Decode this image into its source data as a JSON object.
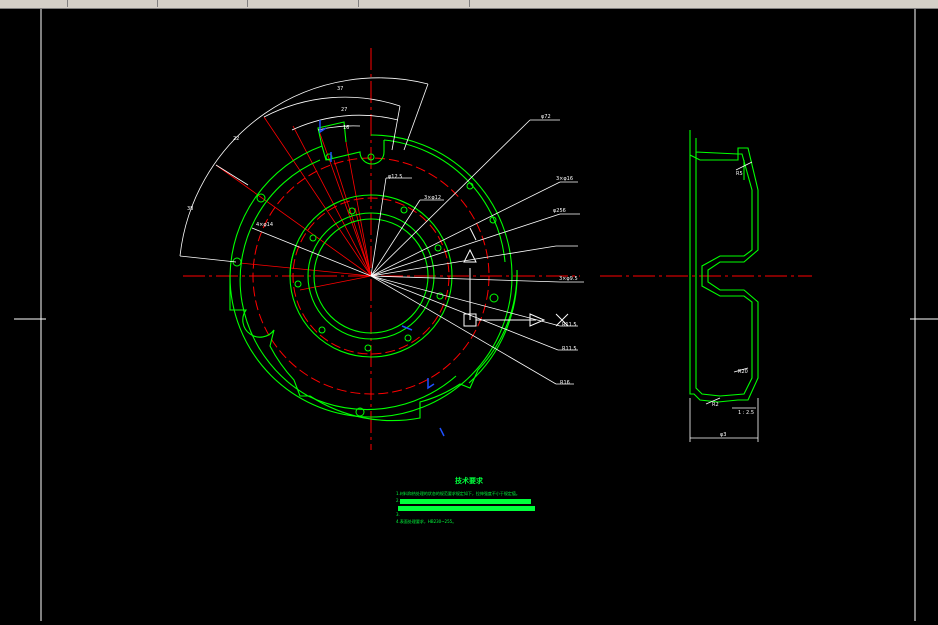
{
  "colors": {
    "background": "#000000",
    "outline": "#00ff00",
    "centerline": "#ff0000",
    "dimension": "#ffffff",
    "frame": "#ffffff",
    "icon_blue": "#1e50ff",
    "note_bar": "#00ff3c",
    "toolbar": "#d4d0c8"
  },
  "toolbar": {
    "icons": [
      "new-icon",
      "save-icon",
      "print-icon",
      "preview-icon",
      "cut-icon",
      "copy-icon",
      "paste-icon",
      "match-icon",
      "undo-icon",
      "redo-icon",
      "hyperlink-icon",
      "pan-icon",
      "zoom-icon",
      "zoom-window-icon",
      "zoom-previous-icon",
      "properties-icon",
      "design-center-icon",
      "tool-palette-icon",
      "sheetset-icon",
      "markup-icon",
      "calc-icon",
      "help-icon",
      "layer-icon",
      "layer-state-icon",
      "bulb-icon",
      "sun-icon",
      "lock-icon"
    ]
  },
  "drawing": {
    "front_view": {
      "dims": {
        "r1": "37",
        "r2": "27",
        "r3": "16",
        "angle_left": "22",
        "angle_outer": "38",
        "thickness": "φ12.5",
        "holes_a": "3×φ12",
        "holes_b": "4×φ14",
        "ext_top": "φ72",
        "ext_2": "3×φ16",
        "ext_3": "φ256",
        "ext_4": "3×φ9.5",
        "ext_5": "R11.5",
        "ext_6": "R11.5",
        "ext_7": "R16"
      }
    },
    "section_view": {
      "labels": {
        "r_top": "R5",
        "r_mid": "R20",
        "r_bottom": "R2",
        "slope": "1 : 2.5",
        "width": "φ3"
      }
    },
    "notes": {
      "title": "技术要求",
      "line1": "1.材料和热处理的状态的规范要求规定如下，拉伸强度不小于规定值。",
      "line2": "2.",
      "line3": "",
      "line4": "3.",
      "line5": "4.表面处理要求，HB230~255。"
    }
  }
}
